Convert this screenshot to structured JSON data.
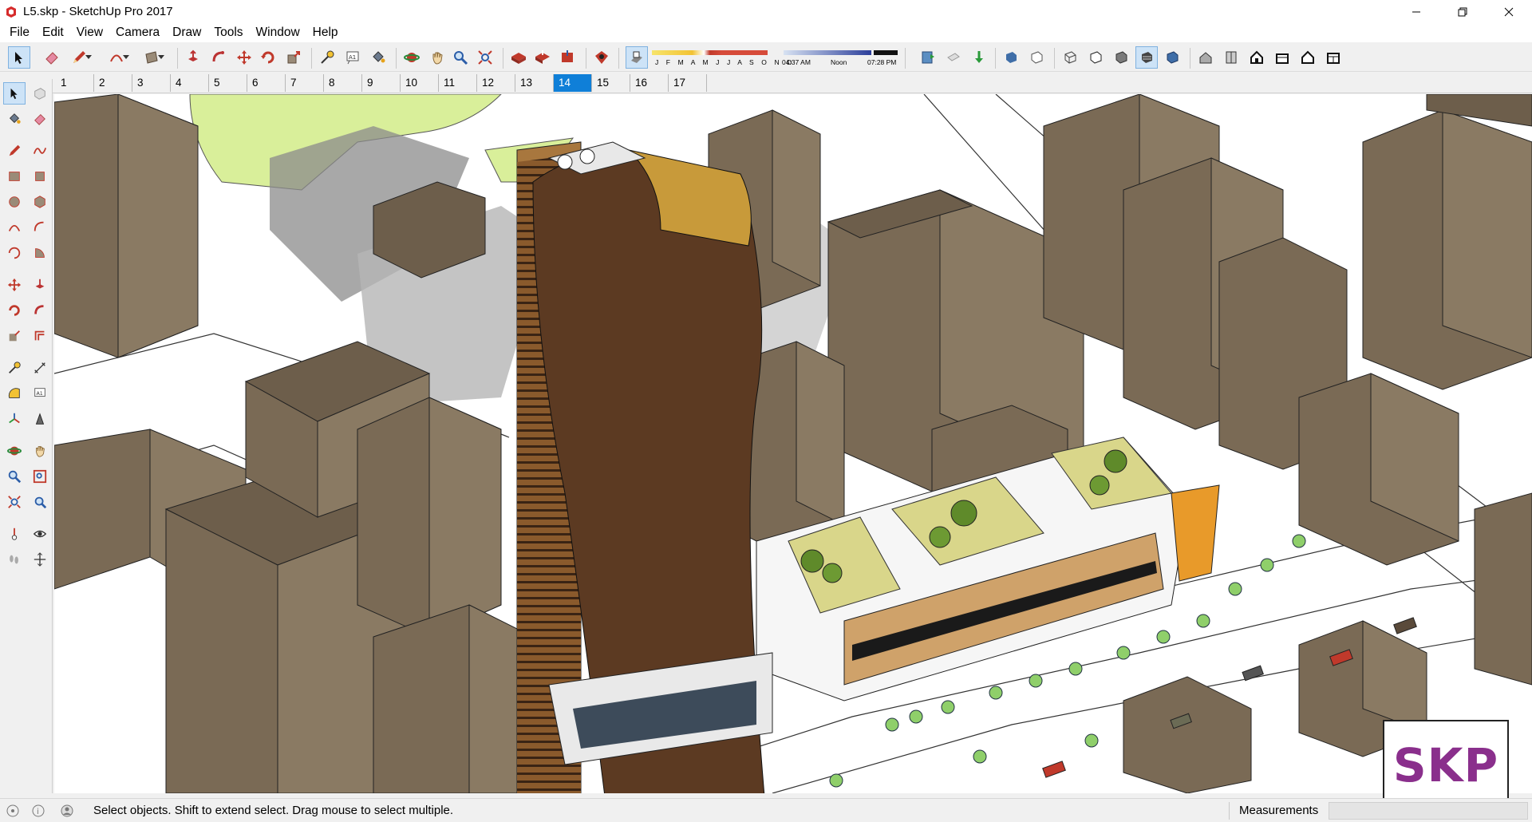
{
  "window": {
    "title": "L5.skp - SketchUp Pro 2017"
  },
  "menu": {
    "items": [
      "File",
      "Edit",
      "View",
      "Camera",
      "Draw",
      "Tools",
      "Window",
      "Help"
    ]
  },
  "shadows": {
    "months": "J F M A M J J A S O N D",
    "time_start": "04:37 AM",
    "time_mid": "Noon",
    "time_end": "07:28 PM"
  },
  "scenes": {
    "tabs": [
      "1",
      "2",
      "3",
      "4",
      "5",
      "6",
      "7",
      "8",
      "9",
      "10",
      "11",
      "12",
      "13",
      "14",
      "15",
      "16",
      "17"
    ],
    "active": "14"
  },
  "status": {
    "hint": "Select objects. Shift to extend select. Drag mouse to select multiple."
  },
  "measurements": {
    "label": "Measurements",
    "value": ""
  },
  "logo": {
    "text": "SKP"
  },
  "colors": {
    "building": "#7a6a55",
    "ground": "#ffffff",
    "lawn": "#d9ef9a",
    "accent": "#0f7fd8",
    "facade": "#5c3a22"
  }
}
